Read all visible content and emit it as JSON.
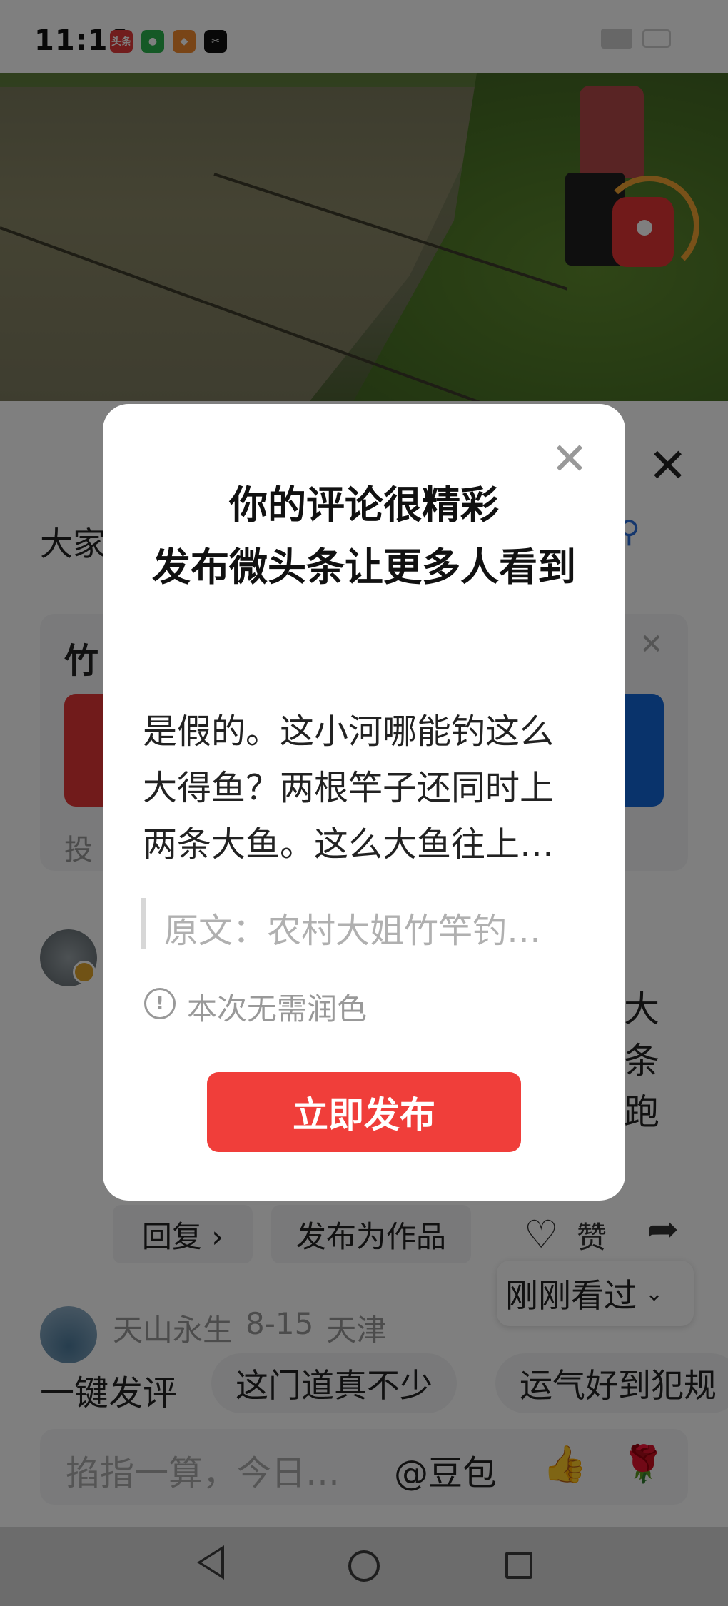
{
  "status_bar": {
    "time": "11:16",
    "apps": [
      {
        "icon": "toutiao-icon",
        "text": "头条",
        "color": "#e33b3b"
      },
      {
        "icon": "wechat-icon",
        "text": "",
        "color": "#2bb24c"
      },
      {
        "icon": "game-app-icon",
        "text": "",
        "color": "#f28a2e"
      },
      {
        "icon": "capcut-icon",
        "text": "✂",
        "color": "#111111"
      }
    ]
  },
  "sheet": {
    "title": "大家",
    "card_title": "竹",
    "card_footer": "投",
    "body_chars": [
      "大",
      "条",
      "跑"
    ],
    "actions": {
      "reply": "回复 ›",
      "publish_work": "发布为作品",
      "like": "赞"
    },
    "recently_viewed": "刚刚看过",
    "second_comment": {
      "user": "天山永生",
      "date": "8-15",
      "location": "天津"
    },
    "quick_comment": {
      "label": "一键发评",
      "chips": [
        "这门道真不少",
        "运气好到犯规"
      ]
    },
    "input": {
      "placeholder": "掐指一算，今日…",
      "mention": "@豆包",
      "emojis": [
        "👍",
        "🌹"
      ]
    }
  },
  "dialog": {
    "title": "你的评论很精彩\n发布微头条让更多人看到",
    "comment_preview": "是假的。这小河哪能钓这么大得鱼？两根竿子还同时上两条大鱼。这么大鱼往上…",
    "original": "原文：农村大姐竹竿钓…",
    "info": "本次无需润色",
    "publish_button": "立即发布"
  },
  "colors": {
    "accent_red": "#f03e3a",
    "link_blue": "#2a6edb",
    "vote_red": "#e23636",
    "vote_blue": "#1366d6"
  }
}
